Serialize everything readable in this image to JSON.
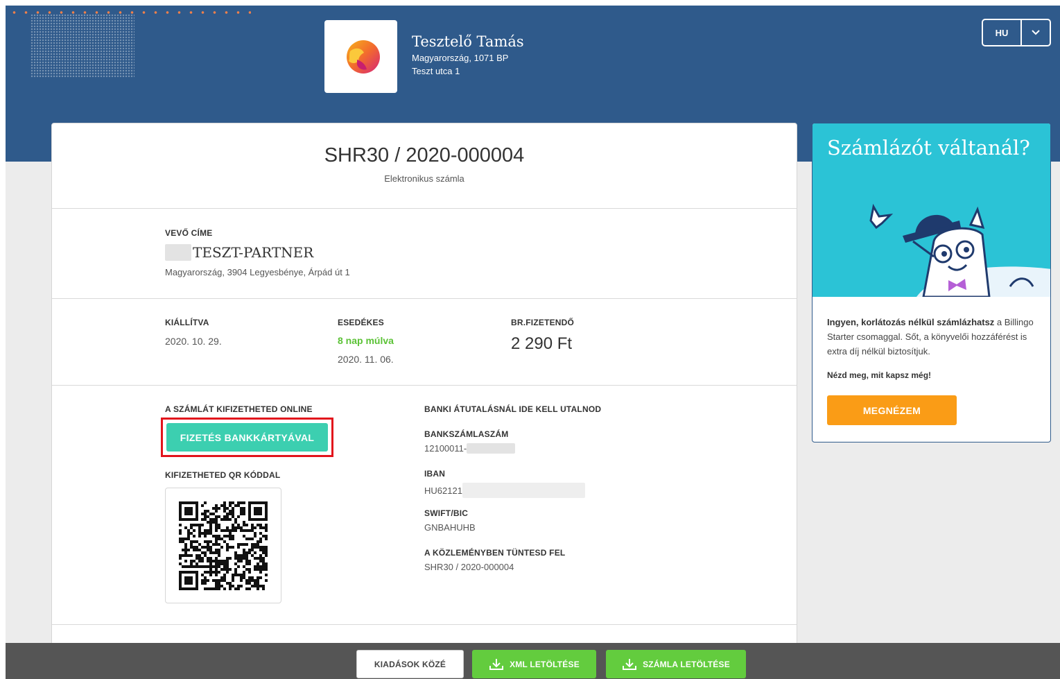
{
  "header": {
    "company_name": "Tesztelő Tamás",
    "address_line1": "Magyarország, 1071 BP",
    "address_line2": "Teszt utca 1",
    "language": "HU"
  },
  "invoice": {
    "number": "SHR30 / 2020-000004",
    "type": "Elektronikus számla"
  },
  "buyer": {
    "label": "VEVŐ CÍME",
    "name": "TESZT-PARTNER",
    "address": "Magyarország, 3904 Legyesbénye, Árpád út 1"
  },
  "dates": {
    "issued_label": "KIÁLLÍTVA",
    "issued_value": "2020. 10. 29.",
    "due_label": "ESEDÉKES",
    "due_relative": "8 nap múlva",
    "due_value": "2020. 11. 06.",
    "total_label": "BR.FIZETENDŐ",
    "total_value": "2 290 Ft"
  },
  "payment": {
    "online_label": "A SZÁMLÁT KIFIZETHETED ONLINE",
    "card_button": "FIZETÉS BANKKÁRTYÁVAL",
    "qr_label": "KIFIZETHETED QR KÓDDAL",
    "bank_transfer_label": "BANKI ÁTUTALÁSNÁL IDE KELL UTALNOD",
    "account_label": "BANKSZÁMLASZÁM",
    "account_value": "12100011-",
    "iban_label": "IBAN",
    "iban_value": "HU62121",
    "swift_label": "SWIFT/BIC",
    "swift_value": "GNBAHUHB",
    "reference_label": "A KÖZLEMÉNYBEN TÜNTESD FEL",
    "reference_value": "SHR30 / 2020-000004"
  },
  "promo": {
    "title": "Számlázót váltanál?",
    "text_bold": "Ingyen, korlátozás nélkül számlázhatsz",
    "text_rest": " a Billingo Starter csomaggal. Sőt, a könyvelői hozzáférést is extra díj nélkül biztosítjuk.",
    "cta_text": "Nézd meg, mit kapsz még!",
    "button": "MEGNÉZEM"
  },
  "footer": {
    "expenses_button": "KIADÁSOK KÖZÉ",
    "xml_button": "XML LETÖLTÉSE",
    "invoice_button": "SZÁMLA LETÖLTÉSE"
  },
  "colors": {
    "header_bg": "#2f5a8b",
    "pay_button": "#3ccfb0",
    "highlight_frame": "#e2141c",
    "due_green": "#5bc236",
    "promo_bg": "#2bc3d6",
    "promo_button": "#fa9c16",
    "footer_bg": "#555555",
    "download_button": "#63cc3e"
  },
  "icons": [
    "lion-logo-icon",
    "chevron-down-icon",
    "mascot-illustration",
    "download-icon",
    "qr-code-image"
  ]
}
